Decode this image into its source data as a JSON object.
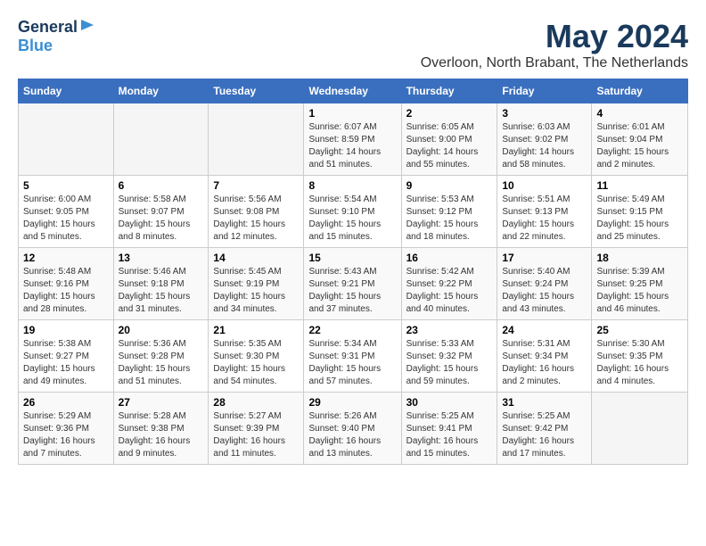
{
  "logo": {
    "general": "General",
    "blue": "Blue"
  },
  "header": {
    "month": "May 2024",
    "location": "Overloon, North Brabant, The Netherlands"
  },
  "weekdays": [
    "Sunday",
    "Monday",
    "Tuesday",
    "Wednesday",
    "Thursday",
    "Friday",
    "Saturday"
  ],
  "weeks": [
    [
      {
        "day": "",
        "info": ""
      },
      {
        "day": "",
        "info": ""
      },
      {
        "day": "",
        "info": ""
      },
      {
        "day": "1",
        "info": "Sunrise: 6:07 AM\nSunset: 8:59 PM\nDaylight: 14 hours and 51 minutes."
      },
      {
        "day": "2",
        "info": "Sunrise: 6:05 AM\nSunset: 9:00 PM\nDaylight: 14 hours and 55 minutes."
      },
      {
        "day": "3",
        "info": "Sunrise: 6:03 AM\nSunset: 9:02 PM\nDaylight: 14 hours and 58 minutes."
      },
      {
        "day": "4",
        "info": "Sunrise: 6:01 AM\nSunset: 9:04 PM\nDaylight: 15 hours and 2 minutes."
      }
    ],
    [
      {
        "day": "5",
        "info": "Sunrise: 6:00 AM\nSunset: 9:05 PM\nDaylight: 15 hours and 5 minutes."
      },
      {
        "day": "6",
        "info": "Sunrise: 5:58 AM\nSunset: 9:07 PM\nDaylight: 15 hours and 8 minutes."
      },
      {
        "day": "7",
        "info": "Sunrise: 5:56 AM\nSunset: 9:08 PM\nDaylight: 15 hours and 12 minutes."
      },
      {
        "day": "8",
        "info": "Sunrise: 5:54 AM\nSunset: 9:10 PM\nDaylight: 15 hours and 15 minutes."
      },
      {
        "day": "9",
        "info": "Sunrise: 5:53 AM\nSunset: 9:12 PM\nDaylight: 15 hours and 18 minutes."
      },
      {
        "day": "10",
        "info": "Sunrise: 5:51 AM\nSunset: 9:13 PM\nDaylight: 15 hours and 22 minutes."
      },
      {
        "day": "11",
        "info": "Sunrise: 5:49 AM\nSunset: 9:15 PM\nDaylight: 15 hours and 25 minutes."
      }
    ],
    [
      {
        "day": "12",
        "info": "Sunrise: 5:48 AM\nSunset: 9:16 PM\nDaylight: 15 hours and 28 minutes."
      },
      {
        "day": "13",
        "info": "Sunrise: 5:46 AM\nSunset: 9:18 PM\nDaylight: 15 hours and 31 minutes."
      },
      {
        "day": "14",
        "info": "Sunrise: 5:45 AM\nSunset: 9:19 PM\nDaylight: 15 hours and 34 minutes."
      },
      {
        "day": "15",
        "info": "Sunrise: 5:43 AM\nSunset: 9:21 PM\nDaylight: 15 hours and 37 minutes."
      },
      {
        "day": "16",
        "info": "Sunrise: 5:42 AM\nSunset: 9:22 PM\nDaylight: 15 hours and 40 minutes."
      },
      {
        "day": "17",
        "info": "Sunrise: 5:40 AM\nSunset: 9:24 PM\nDaylight: 15 hours and 43 minutes."
      },
      {
        "day": "18",
        "info": "Sunrise: 5:39 AM\nSunset: 9:25 PM\nDaylight: 15 hours and 46 minutes."
      }
    ],
    [
      {
        "day": "19",
        "info": "Sunrise: 5:38 AM\nSunset: 9:27 PM\nDaylight: 15 hours and 49 minutes."
      },
      {
        "day": "20",
        "info": "Sunrise: 5:36 AM\nSunset: 9:28 PM\nDaylight: 15 hours and 51 minutes."
      },
      {
        "day": "21",
        "info": "Sunrise: 5:35 AM\nSunset: 9:30 PM\nDaylight: 15 hours and 54 minutes."
      },
      {
        "day": "22",
        "info": "Sunrise: 5:34 AM\nSunset: 9:31 PM\nDaylight: 15 hours and 57 minutes."
      },
      {
        "day": "23",
        "info": "Sunrise: 5:33 AM\nSunset: 9:32 PM\nDaylight: 15 hours and 59 minutes."
      },
      {
        "day": "24",
        "info": "Sunrise: 5:31 AM\nSunset: 9:34 PM\nDaylight: 16 hours and 2 minutes."
      },
      {
        "day": "25",
        "info": "Sunrise: 5:30 AM\nSunset: 9:35 PM\nDaylight: 16 hours and 4 minutes."
      }
    ],
    [
      {
        "day": "26",
        "info": "Sunrise: 5:29 AM\nSunset: 9:36 PM\nDaylight: 16 hours and 7 minutes."
      },
      {
        "day": "27",
        "info": "Sunrise: 5:28 AM\nSunset: 9:38 PM\nDaylight: 16 hours and 9 minutes."
      },
      {
        "day": "28",
        "info": "Sunrise: 5:27 AM\nSunset: 9:39 PM\nDaylight: 16 hours and 11 minutes."
      },
      {
        "day": "29",
        "info": "Sunrise: 5:26 AM\nSunset: 9:40 PM\nDaylight: 16 hours and 13 minutes."
      },
      {
        "day": "30",
        "info": "Sunrise: 5:25 AM\nSunset: 9:41 PM\nDaylight: 16 hours and 15 minutes."
      },
      {
        "day": "31",
        "info": "Sunrise: 5:25 AM\nSunset: 9:42 PM\nDaylight: 16 hours and 17 minutes."
      },
      {
        "day": "",
        "info": ""
      }
    ]
  ]
}
